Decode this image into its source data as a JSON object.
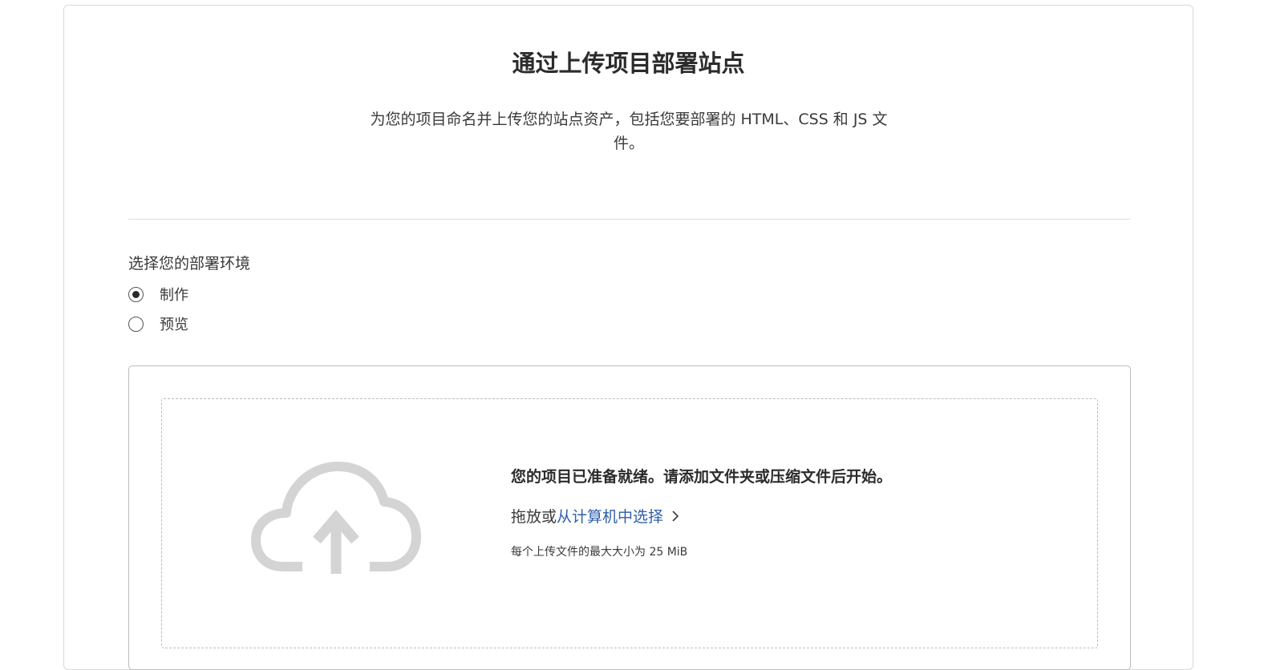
{
  "header": {
    "title": "通过上传项目部署站点",
    "subtitle": "为您的项目命名并上传您的站点资产，包括您要部署的 HTML、CSS 和 JS 文件。"
  },
  "environment": {
    "label": "选择您的部署环境",
    "options": [
      {
        "label": "制作",
        "selected": true
      },
      {
        "label": "预览",
        "selected": false
      }
    ]
  },
  "upload": {
    "ready_text": "您的项目已准备就绪。请添加文件夹或压缩文件后开始。",
    "drag_prefix": "拖放或",
    "choose_link": "从计算机中选择",
    "max_size": "每个上传文件的最大大小为 25 MiB",
    "icon": "cloud-upload-icon",
    "icon_color": "#d4d4d4",
    "link_color": "#2e5fa8"
  }
}
